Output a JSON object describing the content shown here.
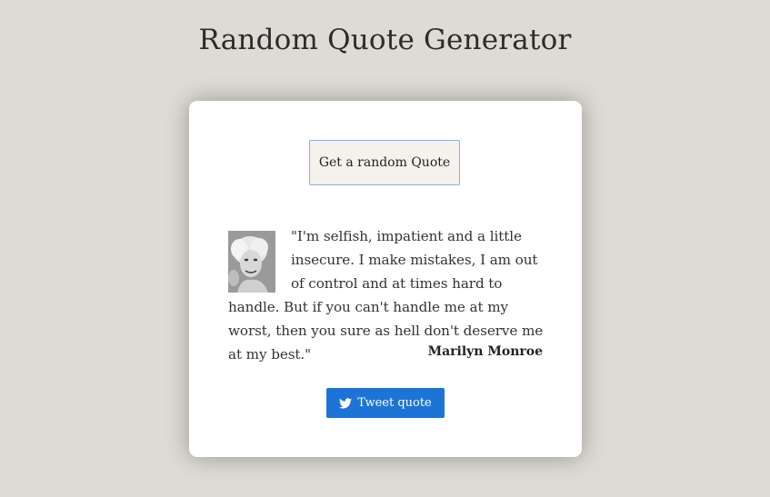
{
  "page": {
    "title": "Random Quote Generator"
  },
  "card": {
    "get_quote_label": "Get a random Quote",
    "quote_text": "\"I'm selfish, impatient and a little insecure. I make mistakes, I am out of control and at times hard to handle. But if you can't handle me at my worst, then you sure as hell don't deserve me at my best.\"",
    "author": "Marilyn Monroe",
    "tweet_label": "Tweet quote",
    "tweet_icon": "twitter-icon"
  },
  "colors": {
    "background": "#dedbd5",
    "card": "#ffffff",
    "get_quote_button_bg": "#f5f1ec",
    "get_quote_button_border": "#8eb0e0",
    "tweet_button": "#1e74d6"
  }
}
